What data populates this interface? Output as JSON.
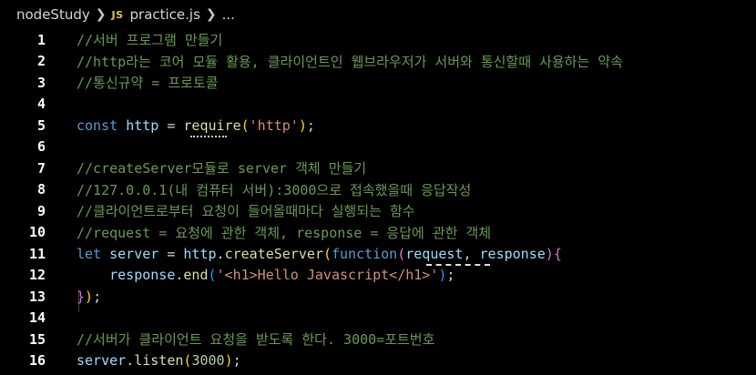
{
  "breadcrumb": {
    "folder": "nodeStudy",
    "file_badge": "JS",
    "file": "practice.js",
    "tail": "..."
  },
  "lines": [
    {
      "n": "1",
      "tokens": [
        {
          "t": "//서버 프로그램 만들기",
          "c": "c"
        }
      ]
    },
    {
      "n": "2",
      "tokens": [
        {
          "t": "//http라는 코어 모듈 활용, 클라이언트인 웹브라우저가 서버와 통신할때 사용하는 약속",
          "c": "c"
        }
      ]
    },
    {
      "n": "3",
      "tokens": [
        {
          "t": "//통신규약 = 프로토콜",
          "c": "c"
        }
      ]
    },
    {
      "n": "4",
      "tokens": []
    },
    {
      "n": "5",
      "tokens": [
        {
          "t": "const",
          "c": "kw"
        },
        {
          "t": " ",
          "c": "pun"
        },
        {
          "t": "http",
          "c": "var"
        },
        {
          "t": " = ",
          "c": "pun"
        },
        {
          "t": "require",
          "c": "fn"
        },
        {
          "t": "(",
          "c": "br1"
        },
        {
          "t": "'http'",
          "c": "str"
        },
        {
          "t": ")",
          "c": "br1"
        },
        {
          "t": ";",
          "c": "pun"
        }
      ]
    },
    {
      "n": "6",
      "tokens": []
    },
    {
      "n": "7",
      "tokens": [
        {
          "t": "//createServer모듈로 server 객체 만들기",
          "c": "c"
        }
      ]
    },
    {
      "n": "8",
      "tokens": [
        {
          "t": "//127.0.0.1(내 컴퓨터 서버):3000으로 접속했을때 응답작성",
          "c": "c"
        }
      ]
    },
    {
      "n": "9",
      "tokens": [
        {
          "t": "//클라이언트로부터 요청이 들어올때마다 실행되는 함수",
          "c": "c"
        }
      ]
    },
    {
      "n": "10",
      "tokens": [
        {
          "t": "//request = 요청에 관한 객체, response = 응답에 관한 객체",
          "c": "c"
        }
      ]
    },
    {
      "n": "11",
      "tokens": [
        {
          "t": "let",
          "c": "kw"
        },
        {
          "t": " ",
          "c": "pun"
        },
        {
          "t": "server",
          "c": "var"
        },
        {
          "t": " = ",
          "c": "pun"
        },
        {
          "t": "http",
          "c": "var"
        },
        {
          "t": ".",
          "c": "pun"
        },
        {
          "t": "createServer",
          "c": "fn"
        },
        {
          "t": "(",
          "c": "br1"
        },
        {
          "t": "function",
          "c": "kw"
        },
        {
          "t": "(",
          "c": "br2"
        },
        {
          "t": "request",
          "c": "var"
        },
        {
          "t": ", ",
          "c": "pun"
        },
        {
          "t": "response",
          "c": "var"
        },
        {
          "t": ")",
          "c": "br2"
        },
        {
          "t": "{",
          "c": "br2"
        }
      ]
    },
    {
      "n": "12",
      "tokens": [
        {
          "t": "    ",
          "c": "pun"
        },
        {
          "t": "response",
          "c": "var"
        },
        {
          "t": ".",
          "c": "pun"
        },
        {
          "t": "end",
          "c": "fn"
        },
        {
          "t": "(",
          "c": "br3"
        },
        {
          "t": "'<h1>Hello Javascript</h1>'",
          "c": "str"
        },
        {
          "t": ")",
          "c": "br3"
        },
        {
          "t": ";",
          "c": "pun"
        }
      ]
    },
    {
      "n": "13",
      "tokens": [
        {
          "t": "}",
          "c": "br2"
        },
        {
          "t": ")",
          "c": "br1"
        },
        {
          "t": ";",
          "c": "pun"
        }
      ]
    },
    {
      "n": "14",
      "tokens": []
    },
    {
      "n": "15",
      "tokens": [
        {
          "t": "//서버가 클라이언트 요청을 받도록 한다. 3000=포트번호",
          "c": "c"
        }
      ]
    },
    {
      "n": "16",
      "tokens": [
        {
          "t": "server",
          "c": "var"
        },
        {
          "t": ".",
          "c": "pun"
        },
        {
          "t": "listen",
          "c": "fn"
        },
        {
          "t": "(",
          "c": "br1"
        },
        {
          "t": "3000",
          "c": "num"
        },
        {
          "t": ")",
          "c": "br1"
        },
        {
          "t": ";",
          "c": "pun"
        }
      ]
    }
  ]
}
